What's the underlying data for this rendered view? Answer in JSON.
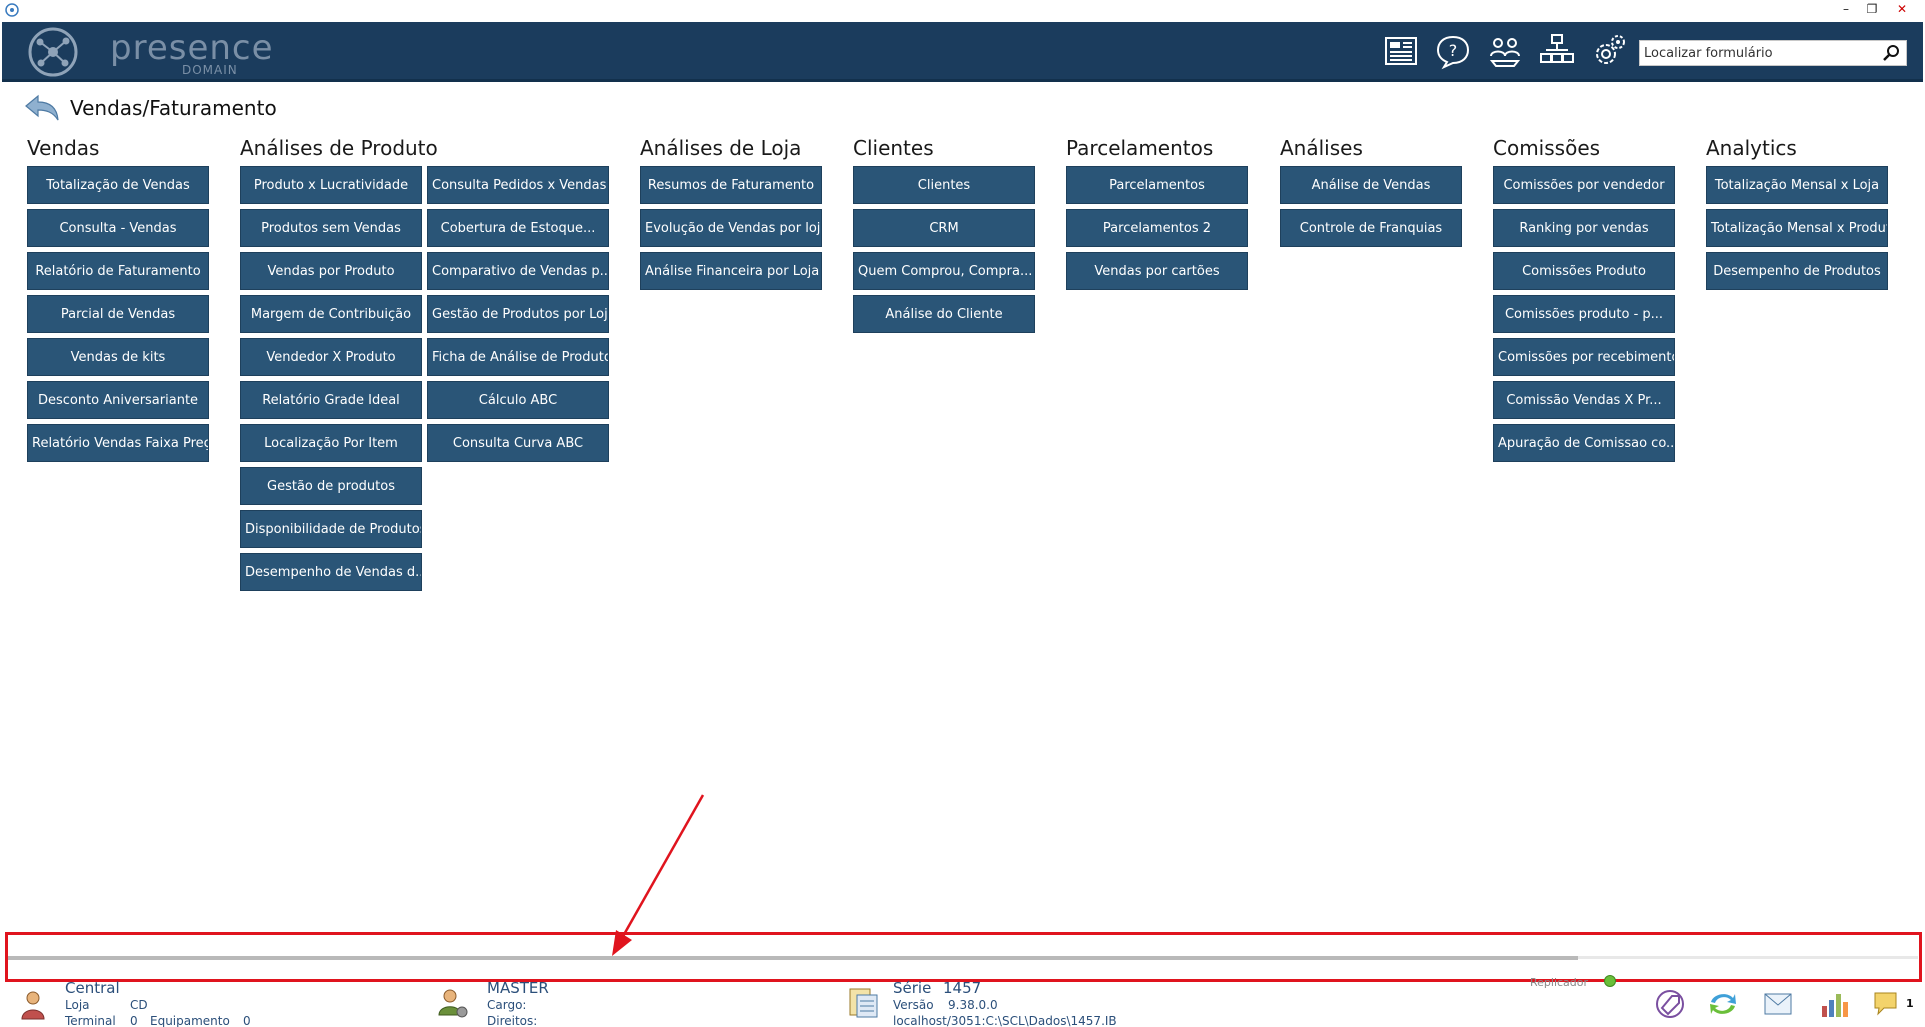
{
  "app": {
    "title": "Presence Domain",
    "logo_text": "presence",
    "logo_sub": "DOMAIN"
  },
  "window_controls": {
    "minimize": "–",
    "maximize": "❐",
    "close": "✕"
  },
  "header": {
    "icons": [
      "news-icon",
      "help-icon",
      "users-icon",
      "network-icon",
      "settings-icon"
    ],
    "search_placeholder": "Localizar formulário"
  },
  "page": {
    "title": "Vendas/Faturamento"
  },
  "groups": [
    {
      "title": "Vendas",
      "columns": [
        [
          "Totalização de Vendas",
          "Consulta - Vendas",
          "Relatório de Faturamento",
          "Parcial de Vendas",
          "Vendas de kits",
          "Desconto Aniversariante",
          "Relatório Vendas Faixa Preço"
        ]
      ]
    },
    {
      "title": "Análises de Produto",
      "columns": [
        [
          "Produto x Lucratividade",
          "Produtos sem Vendas",
          "Vendas por Produto",
          "Margem de Contribuição",
          "Vendedor X Produto",
          "Relatório Grade Ideal",
          "Localização Por Item",
          "Gestão de produtos",
          "Disponibilidade de Produtos...",
          "Desempenho de Vendas d..."
        ],
        [
          "Consulta Pedidos x Vendas",
          "Cobertura de Estoque...",
          "Comparativo de Vendas p...",
          "Gestão de Produtos por Loja",
          "Ficha de Análise de Produto",
          "Cálculo ABC",
          "Consulta Curva ABC"
        ]
      ]
    },
    {
      "title": "Análises de Loja",
      "columns": [
        [
          "Resumos de Faturamento",
          "Evolução de Vendas por loja",
          "Análise Financeira por Loja"
        ]
      ]
    },
    {
      "title": "Clientes",
      "columns": [
        [
          "Clientes",
          "CRM",
          "Quem Comprou, Compra...",
          "Análise do Cliente"
        ]
      ]
    },
    {
      "title": "Parcelamentos",
      "columns": [
        [
          "Parcelamentos",
          "Parcelamentos 2",
          "Vendas por cartões"
        ]
      ]
    },
    {
      "title": "Análises",
      "columns": [
        [
          "Análise de Vendas",
          "Controle de Franquias"
        ]
      ]
    },
    {
      "title": "Comissões",
      "columns": [
        [
          "Comissões por vendedor",
          "Ranking por vendas",
          "Comissões Produto",
          "Comissões produto - p...",
          "Comissões por recebimento",
          "Comissão Vendas X Pr...",
          "Apuração de Comissao co..."
        ]
      ]
    },
    {
      "title": "Analytics",
      "columns": [
        [
          "Totalização Mensal x Loja",
          "Totalização Mensal x Produto",
          "Desempenho de Produtos"
        ]
      ]
    }
  ],
  "status": {
    "store_name": "Central",
    "loja_label": "Loja",
    "loja_value": "CD",
    "terminal_label": "Terminal",
    "terminal_value": "0",
    "equip_label": "Equipamento",
    "equip_value": "0",
    "user_name": "MASTER",
    "cargo_label": "Cargo:",
    "direitos_label": "Direitos:",
    "serie_label": "Série",
    "serie_value": "1457",
    "versao_label": "Versão",
    "versao_value": "9.38.0.0",
    "db_path": "localhost/3051:C:\\SCL\\Dados\\1457.IB",
    "replicador_label": "Replicador",
    "notification_count": "1"
  },
  "colors": {
    "header_bg": "#1b3c5d",
    "button_bg": "#2a5577",
    "highlight": "#e0141e"
  }
}
